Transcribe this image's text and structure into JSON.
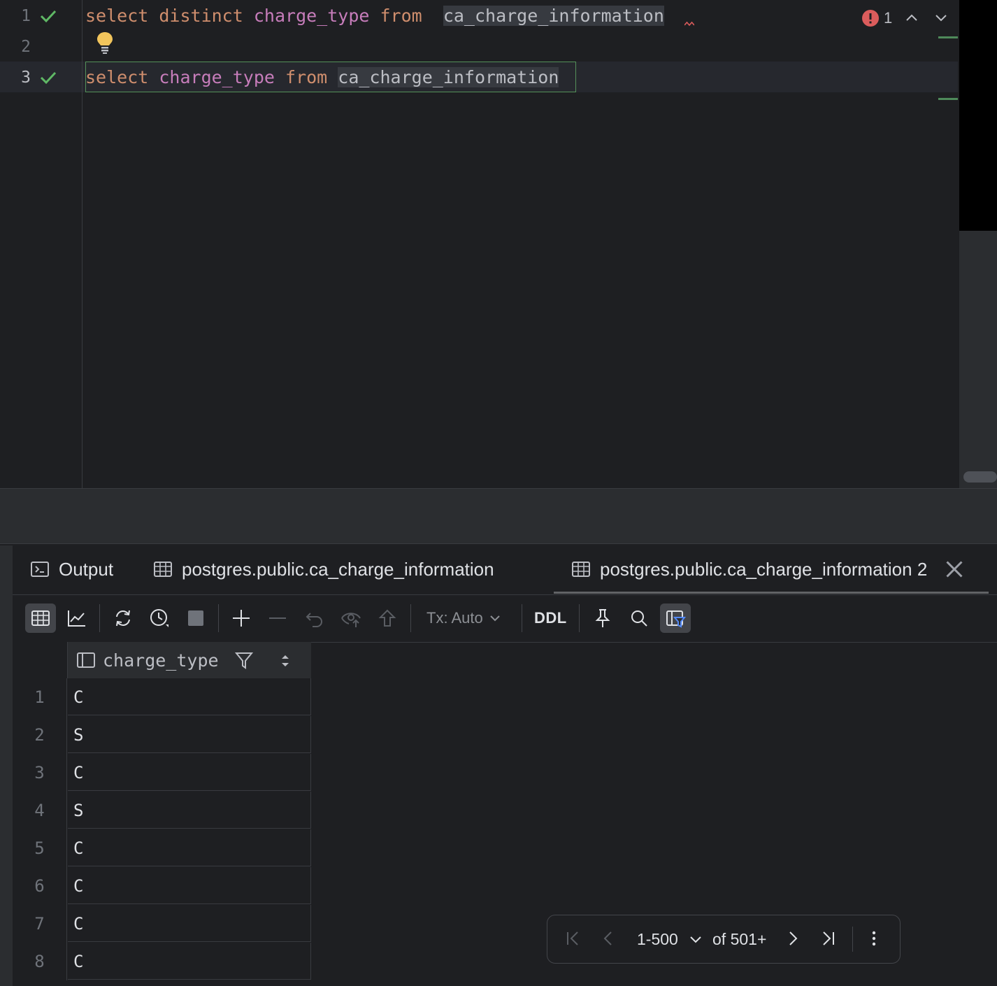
{
  "editor": {
    "line_numbers": [
      "1",
      "2",
      "3"
    ],
    "line1": {
      "kw_select": "select",
      "kw_distinct": "distinct",
      "column": "charge_type",
      "kw_from": "from",
      "table": "ca_charge_information"
    },
    "line3": {
      "kw_select": "select",
      "column": "charge_type",
      "kw_from": "from",
      "table": "ca_charge_information"
    },
    "error_count": "1",
    "icons": [
      "check-icon",
      "bulb-icon",
      "error-icon",
      "chevron-up-icon",
      "chevron-down-icon"
    ]
  },
  "results": {
    "tabs": [
      {
        "label": "Output",
        "icon": "console-icon"
      },
      {
        "label": "postgres.public.ca_charge_information",
        "icon": "table-icon"
      },
      {
        "label": "postgres.public.ca_charge_information 2",
        "icon": "table-icon",
        "active": true
      }
    ],
    "toolbar": {
      "tx_label": "Tx: Auto",
      "ddl_label": "DDL",
      "icons": [
        "table-view-icon",
        "chart-icon",
        "refresh-icon",
        "history-icon",
        "stop-icon",
        "add-row-icon",
        "delete-row-icon",
        "revert-icon",
        "preview-pending-icon",
        "submit-icon",
        "pin-icon",
        "search-icon",
        "filter-panel-icon"
      ]
    },
    "grid": {
      "column": "charge_type",
      "rows": [
        {
          "n": "1",
          "v": "C"
        },
        {
          "n": "2",
          "v": "S"
        },
        {
          "n": "3",
          "v": "C"
        },
        {
          "n": "4",
          "v": "S"
        },
        {
          "n": "5",
          "v": "C"
        },
        {
          "n": "6",
          "v": "C"
        },
        {
          "n": "7",
          "v": "C"
        },
        {
          "n": "8",
          "v": "C"
        }
      ]
    },
    "pager": {
      "range": "1-500",
      "of": "of 501+"
    }
  },
  "colors": {
    "keyword": "#cf8e6d",
    "identifier": "#c77dbb",
    "success": "#5fb865",
    "error": "#db5c5c",
    "background": "#1e1f22"
  }
}
